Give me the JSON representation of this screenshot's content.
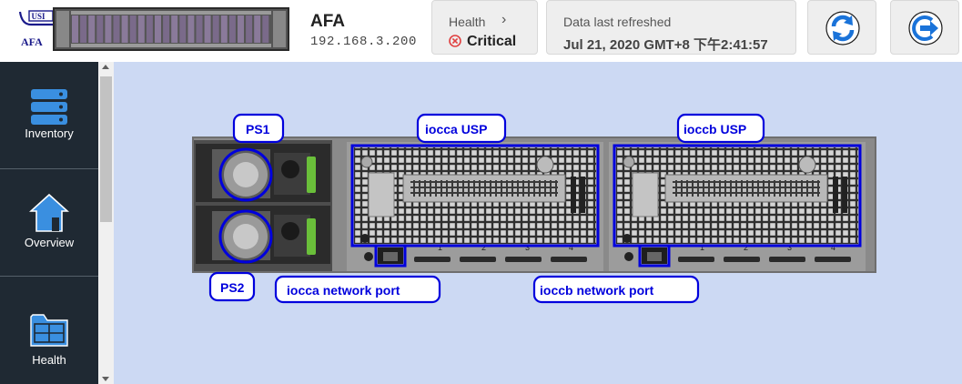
{
  "header": {
    "logo_text": "AFA",
    "device_name": "AFA",
    "device_ip": "192.168.3.200",
    "health": {
      "label": "Health",
      "status": "Critical",
      "status_color": "#e04040",
      "icon": "critical-icon"
    },
    "refresh": {
      "label": "Data last refreshed",
      "timestamp": "Jul 21, 2020 GMT+8 下午2:41:57"
    },
    "buttons": [
      {
        "name": "refresh",
        "icon": "refresh-icon",
        "color": "#1a73d9"
      },
      {
        "name": "logout",
        "icon": "logout-icon",
        "color": "#1a73d9"
      }
    ]
  },
  "sidebar": {
    "items": [
      {
        "label": "Inventory",
        "icon": "server-stack-icon"
      },
      {
        "label": "Overview",
        "icon": "home-icon"
      },
      {
        "label": "Health",
        "icon": "folder-icon"
      }
    ],
    "accent": "#3a8fe0"
  },
  "diagram": {
    "labels": {
      "ps1": "PS1",
      "ps2": "PS2",
      "iocca_usp": "iocca USP",
      "ioccb_usp": "ioccb USP",
      "iocca_port": "iocca network port",
      "ioccb_port": "ioccb network port"
    },
    "slot_numbers": [
      "1",
      "2",
      "3",
      "4"
    ],
    "highlight_color": "#0000dd"
  }
}
